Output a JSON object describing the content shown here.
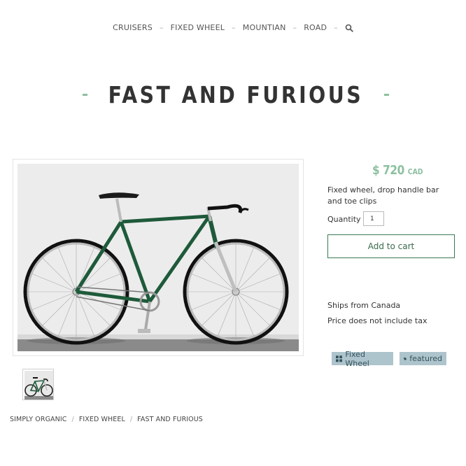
{
  "nav": {
    "items": [
      "CRUISERS",
      "FIXED WHEEL",
      "MOUNTIAN",
      "ROAD"
    ],
    "separator": "–"
  },
  "product": {
    "title": "FAST AND FURIOUS",
    "price": "$ 720",
    "currency": "CAD",
    "description": "Fixed wheel, drop handle bar and toe clips",
    "quantity_label": "Quantity",
    "quantity_value": "1",
    "add_to_cart": "Add to cart",
    "ships": "Ships from Canada",
    "tax": "Price does not include tax"
  },
  "tags": [
    {
      "label": "Fixed Wheel",
      "icon": "grid-icon"
    },
    {
      "label": "featured",
      "icon": "tag-icon"
    }
  ],
  "breadcrumb": [
    "SIMPLY ORGANIC",
    "FIXED WHEEL",
    "FAST AND FURIOUS"
  ],
  "colors": {
    "accent": "#8cc09f",
    "button_border": "#3a7a52",
    "tag_bg": "#aec4cc",
    "bike_frame": "#1e5a3a"
  }
}
